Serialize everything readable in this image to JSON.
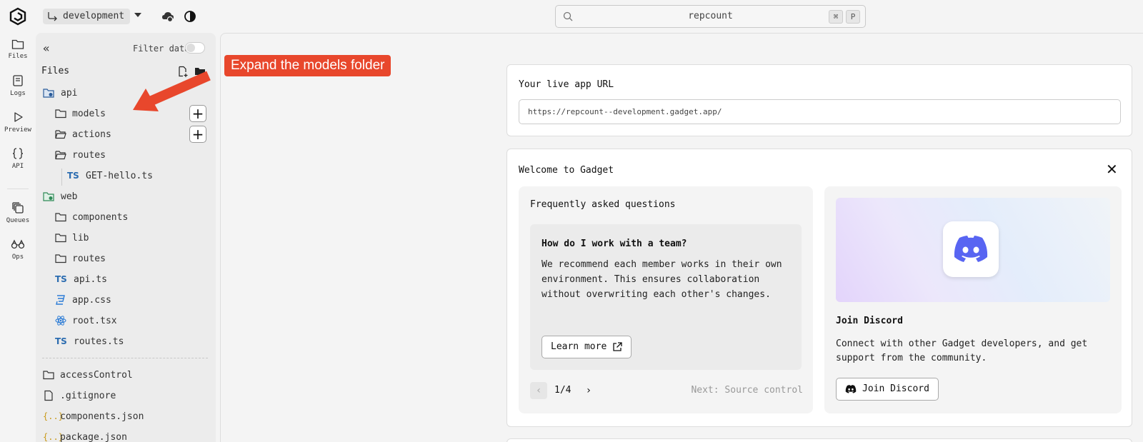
{
  "topbar": {
    "branch": "development",
    "search_value": "repcount",
    "shortcut_keys": [
      "⌘",
      "P"
    ]
  },
  "rail": {
    "items": [
      {
        "label": "Files",
        "icon": "folder-icon"
      },
      {
        "label": "Logs",
        "icon": "logs-icon"
      },
      {
        "label": "Preview",
        "icon": "play-icon"
      },
      {
        "label": "API",
        "icon": "braces-icon"
      },
      {
        "label": "Queues",
        "icon": "queues-icon"
      },
      {
        "label": "Ops",
        "icon": "binoculars-icon"
      }
    ]
  },
  "filepanel": {
    "filter_label": "Filter data",
    "files_title": "Files",
    "tree": {
      "api": "api",
      "models": "models",
      "actions": "actions",
      "api_routes": "routes",
      "get_hello": "GET-hello.ts",
      "web": "web",
      "components": "components",
      "lib": "lib",
      "web_routes": "routes",
      "api_ts": "api.ts",
      "app_css": "app.css",
      "root_tsx": "root.tsx",
      "routes_ts": "routes.ts",
      "access_control": "accessControl",
      "gitignore": ".gitignore",
      "components_json": "components.json",
      "package_json": "package.json"
    },
    "ts_badge": "TS"
  },
  "url_card": {
    "label": "Your live app URL",
    "url": "https://repcount--development.gadget.app/"
  },
  "welcome": {
    "title": "Welcome to Gadget",
    "faq_title": "Frequently asked questions",
    "question": "How do I work with a team?",
    "answer": "We recommend each member works in their own environment. This ensures collaboration without overwriting each other's changes.",
    "learn_more": "Learn more",
    "pager": "1/4",
    "next_label": "Next: Source control",
    "discord_title": "Join Discord",
    "discord_desc": "Connect with other Gadget developers, and get support from the community.",
    "join_button": "Join Discord"
  },
  "annotation": {
    "text": "Expand the models folder",
    "color": "#e8472c"
  }
}
